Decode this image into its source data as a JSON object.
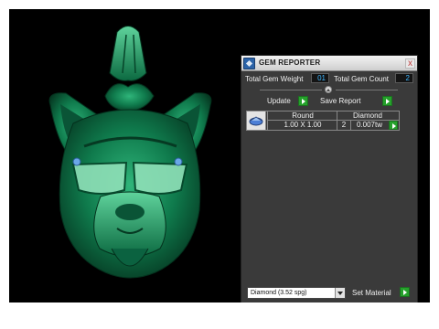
{
  "panel": {
    "title": "GEM REPORTER",
    "close": "x",
    "total_weight_label": "Total Gem Weight",
    "total_weight_value": "01",
    "total_count_label": "Total Gem Count",
    "total_count_value": "2",
    "update_label": "Update",
    "save_report_label": "Save Report"
  },
  "gem_table": {
    "cut": "Round",
    "material": "Diamond",
    "size": "1.00 X 1.00",
    "count": "2",
    "weight": "0.007tw"
  },
  "footer": {
    "material_select": "Diamond    (3.52 spg)",
    "set_material_label": "Set Material"
  },
  "colors": {
    "pendant_green": "#0f7a4c",
    "background": "#000000",
    "accent_blue": "#3fb7ff",
    "go_green": "#25a12b"
  }
}
